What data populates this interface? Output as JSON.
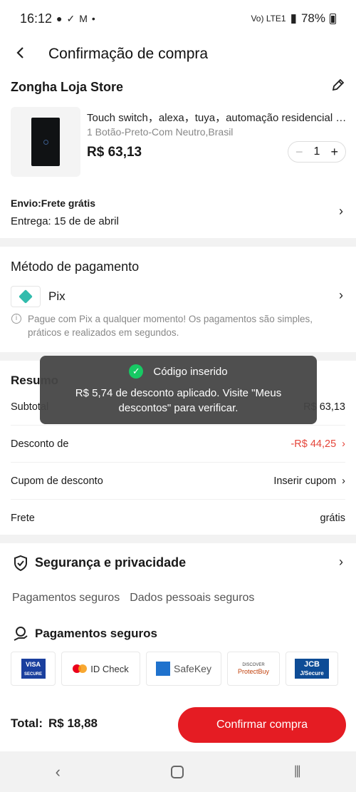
{
  "status_bar": {
    "time": "16:12",
    "battery": "78%",
    "network": "Vo) LTE1"
  },
  "header": {
    "title": "Confirmação de compra"
  },
  "store": {
    "name": "Zongha Loja Store",
    "product_name": "Touch switch，alexa，tuya，automação residencial inteligente",
    "product_variant": "1 Botão-Preto-Com Neutro,Brasil",
    "price": "R$ 63,13",
    "quantity": "1",
    "shipping": "Envio:Frete grátis",
    "delivery": "Entrega: 15 de de abril"
  },
  "payment": {
    "title": "Método de pagamento",
    "method": "Pix",
    "info": "Pague com Pix a qualquer momento! Os pagamentos são simples, práticos e realizados em segundos."
  },
  "summary": {
    "title": "Resumo",
    "rows": [
      {
        "label": "Subtotal",
        "value": "R$ 63,13"
      },
      {
        "label": "Desconto de",
        "value": "-R$ 44,25"
      },
      {
        "label": "Cupom de desconto",
        "value": "Inserir cupom"
      },
      {
        "label": "Frete",
        "value": "grátis"
      }
    ]
  },
  "security": {
    "title": "Segurança e privacidade",
    "tabs": [
      "Pagamentos seguros",
      "Dados pessoais seguros"
    ],
    "subtitle": "Pagamentos seguros",
    "badges": {
      "visa": "VISA",
      "visa_sub": "SECURE",
      "mastercard": "ID Check",
      "amex": "SafeKey",
      "discover": "ProtectBuy",
      "discover_top": "DISCOVER",
      "jcb": "JCB",
      "jcb_sub": "J/Secure"
    }
  },
  "footer": {
    "total_label": "Total:",
    "total_value": "R$ 18,88",
    "confirm": "Confirmar compra"
  },
  "toast": {
    "title": "Código inserido",
    "message": "R$ 5,74 de desconto aplicado. Visite \"Meus descontos\" para verificar."
  },
  "colors": {
    "accent": "#e51c23",
    "discount": "#e5453a",
    "pix": "#32bcad",
    "success": "#17c964"
  }
}
